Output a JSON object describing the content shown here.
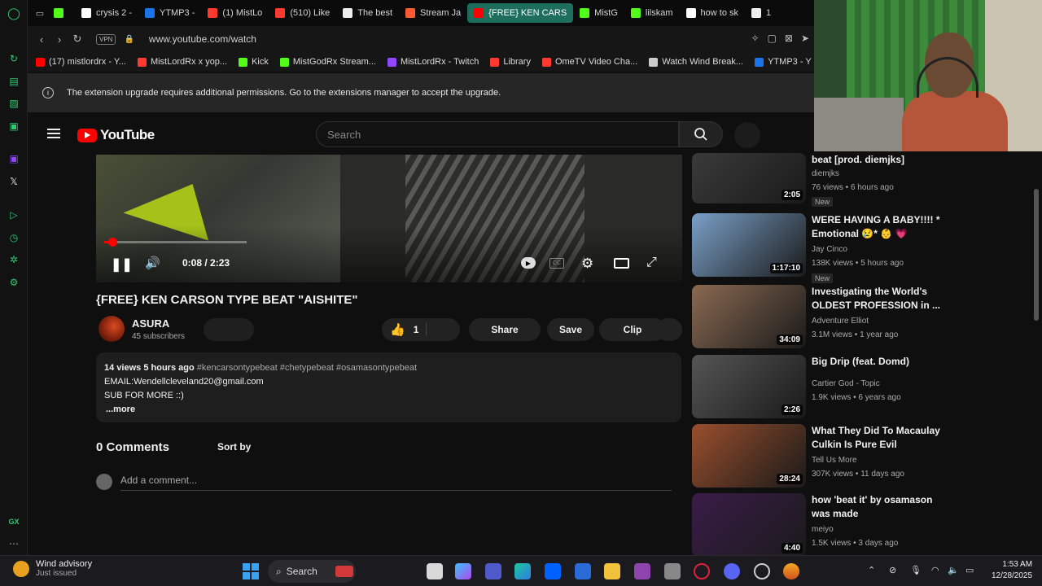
{
  "browser": {
    "tabs": [
      {
        "label": "",
        "color": "#53fc18"
      },
      {
        "label": "crysis 2 -",
        "color": "#ffffff"
      },
      {
        "label": "YTMP3 -",
        "color": "#1a73e8"
      },
      {
        "label": "(1) MistLo",
        "color": "#ff3b30"
      },
      {
        "label": "(510) Like",
        "color": "#ff3b30"
      },
      {
        "label": "The best",
        "color": "#eeeeee"
      },
      {
        "label": "Stream Ja",
        "color": "#ff5a36"
      },
      {
        "label": "{FREE} KEN CARS",
        "color": "#ff0000",
        "active": true
      },
      {
        "label": "MistG",
        "color": "#53fc18"
      },
      {
        "label": "lilskam",
        "color": "#53fc18"
      },
      {
        "label": "how to sk",
        "color": "#ffffff"
      },
      {
        "label": "1",
        "color": "#eeeeee"
      }
    ],
    "url": "www.youtube.com/watch",
    "vpn_label": "VPN",
    "bookmarks": [
      {
        "label": "(17) mistlordrx - Y...",
        "color": "#ff0000"
      },
      {
        "label": "MistLordRx x yop...",
        "color": "#ff3b30"
      },
      {
        "label": "Kick",
        "color": "#53fc18"
      },
      {
        "label": "MistGodRx Stream...",
        "color": "#53fc18"
      },
      {
        "label": "MistLordRx - Twitch",
        "color": "#9146ff"
      },
      {
        "label": "Library",
        "color": "#ff3b30"
      },
      {
        "label": "OmeTV Video Cha...",
        "color": "#ff3b30"
      },
      {
        "label": "Watch Wind Break...",
        "color": "#cccccc"
      },
      {
        "label": "YTMP3 - Y",
        "color": "#1a73e8"
      }
    ],
    "banner_text": "The extension upgrade requires additional permissions. Go to the extensions manager to accept the upgrade."
  },
  "youtube": {
    "logo_text": "YouTube",
    "search_placeholder": "Search",
    "player": {
      "time": "0:08 / 2:23",
      "progress_fraction": 0.056
    },
    "video_title": "{FREE} KEN CARSON TYPE BEAT \"AISHITE\"",
    "channel_name": "ASURA",
    "subscribers": "45 subscribers",
    "likes": "1",
    "share_label": "Share",
    "save_label": "Save",
    "clip_label": "Clip",
    "description": {
      "views": "14 views",
      "age": "5 hours ago",
      "tags": "#kencarsontypebeat #chetypebeat #osamasontypebeat",
      "line1": "EMAIL:Wendellcleveland20@gmail.com",
      "line2": "SUB FOR MORE ::)",
      "more": "...more"
    },
    "comments": {
      "count": "0 Comments",
      "sort_label": "Sort by",
      "placeholder": "Add a comment..."
    },
    "recommendations": [
      {
        "title": "beat [prod. diemjks]",
        "channel": "diemjks",
        "meta": "76 views • 6 hours ago",
        "badge": "New",
        "duration": "2:05",
        "thumb": "#3a3a3a"
      },
      {
        "title": "WERE HAVING A BABY!!!! * Emotional 😢* 👶 💗",
        "channel": "Jay Cinco",
        "meta": "138K views • 5 hours ago",
        "badge": "New",
        "duration": "1:17:10",
        "thumb": "#7aa0c8"
      },
      {
        "title": "Investigating the World's OLDEST PROFESSION in ...",
        "channel": "Adventure Elliot",
        "meta": "3.1M views • 1 year ago",
        "badge": "",
        "duration": "34:09",
        "thumb": "#8a6a52"
      },
      {
        "title": "Big Drip (feat. Domd)",
        "channel": "Cartier God - Topic",
        "meta": "1.9K views • 6 years ago",
        "badge": "",
        "duration": "2:26",
        "thumb": "#555555"
      },
      {
        "title": "What They Did To Macaulay Culkin Is Pure Evil",
        "channel": "Tell Us More",
        "meta": "307K views • 11 days ago",
        "badge": "",
        "duration": "28:24",
        "thumb": "#9a4e2c"
      },
      {
        "title": "how 'beat it' by osamason was made",
        "channel": "meiyo",
        "meta": "1.5K views • 3 days ago",
        "badge": "",
        "duration": "4:40",
        "thumb": "#3a1c48"
      }
    ]
  },
  "taskbar": {
    "weather_title": "Wind advisory",
    "weather_sub": "Just issued",
    "search_label": "Search",
    "time": "1:53 AM",
    "date": "12/28/2025"
  },
  "sidebar": {
    "gx_label": "GX"
  }
}
